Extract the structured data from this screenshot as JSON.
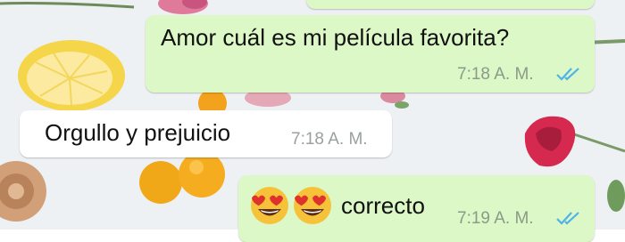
{
  "chat": {
    "messages": [
      {
        "direction": "outgoing",
        "text": "",
        "time": "",
        "status": "read",
        "partially_visible": true
      },
      {
        "direction": "outgoing",
        "text": "Amor cuál es mi película favorita?",
        "time": "7:18 A. M.",
        "status": "read"
      },
      {
        "direction": "incoming",
        "text": "Orgullo y prejuicio",
        "time": "7:18 A. M."
      },
      {
        "direction": "outgoing",
        "emoji": [
          "smiling-face-with-heart-eyes",
          "smiling-face-with-heart-eyes"
        ],
        "text": "correcto",
        "time": "7:19 A. M.",
        "status": "read"
      }
    ]
  },
  "colors": {
    "outgoing_bubble": "#dcf8c6",
    "incoming_bubble": "#ffffff",
    "read_ticks": "#4fb3e8",
    "timestamp": "#8b9a8a",
    "wallpaper": "#eef1f4"
  }
}
